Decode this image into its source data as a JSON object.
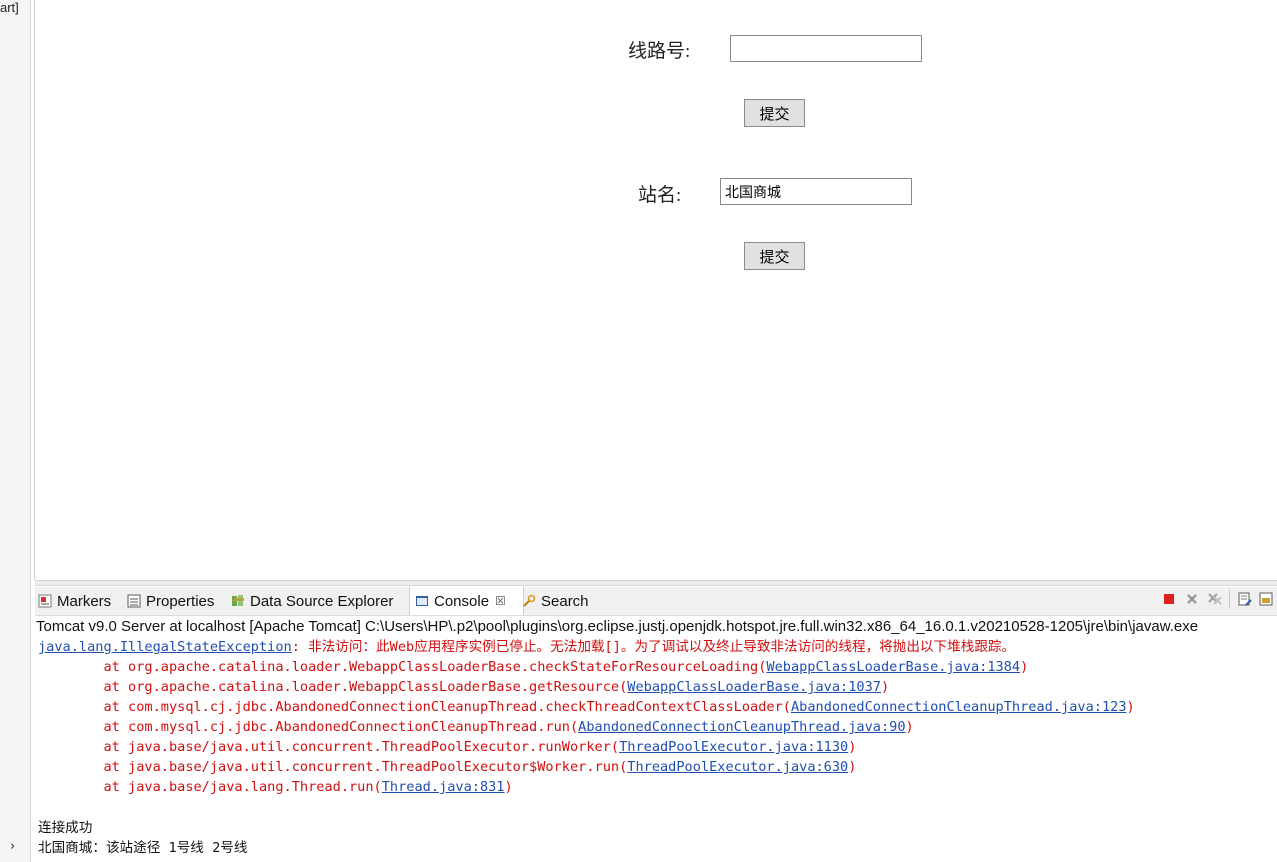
{
  "left_clip_text": "art]",
  "form": {
    "line_label": "线路号:",
    "line_value": "",
    "submit1": "提交",
    "station_label": "站名:",
    "station_value": "北国商城",
    "submit2": "提交"
  },
  "tabs": [
    {
      "label": "Markers",
      "icon": "markers-icon"
    },
    {
      "label": "Properties",
      "icon": "properties-icon"
    },
    {
      "label": "Data Source Explorer",
      "icon": "data-source-icon"
    },
    {
      "label": "Console",
      "icon": "console-icon",
      "close": "☒"
    },
    {
      "label": "Search",
      "icon": "search-icon"
    }
  ],
  "console_title": "Tomcat v9.0 Server at localhost [Apache Tomcat] C:\\Users\\HP\\.p2\\pool\\plugins\\org.eclipse.justj.openjdk.hotspot.jre.full.win32.x86_64_16.0.1.v20210528-1205\\jre\\bin\\javaw.exe",
  "console": {
    "exception_link": "java.lang.IllegalStateException",
    "exception_msg": ": 非法访问：此Web应用程序实例已停止。无法加载[]。为了调试以及终止导致非法访问的线程，将抛出以下堆栈跟踪。",
    "frames": [
      {
        "prefix": "        at org.apache.catalina.loader.WebappClassLoaderBase.checkStateForResourceLoading(",
        "link": "WebappClassLoaderBase.java:1384",
        "suffix": ")"
      },
      {
        "prefix": "        at org.apache.catalina.loader.WebappClassLoaderBase.getResource(",
        "link": "WebappClassLoaderBase.java:1037",
        "suffix": ")"
      },
      {
        "prefix": "        at com.mysql.cj.jdbc.AbandonedConnectionCleanupThread.checkThreadContextClassLoader(",
        "link": "AbandonedConnectionCleanupThread.java:123",
        "suffix": ")"
      },
      {
        "prefix": "        at com.mysql.cj.jdbc.AbandonedConnectionCleanupThread.run(",
        "link": "AbandonedConnectionCleanupThread.java:90",
        "suffix": ")"
      },
      {
        "prefix": "        at java.base/java.util.concurrent.ThreadPoolExecutor.runWorker(",
        "link": "ThreadPoolExecutor.java:1130",
        "suffix": ")"
      },
      {
        "prefix": "        at java.base/java.util.concurrent.ThreadPoolExecutor$Worker.run(",
        "link": "ThreadPoolExecutor.java:630",
        "suffix": ")"
      },
      {
        "prefix": "        at java.base/java.lang.Thread.run(",
        "link": "Thread.java:831",
        "suffix": ")"
      }
    ],
    "output1": "连接成功",
    "output2": "北国商城：该站途径 1号线 2号线"
  },
  "colors": {
    "error": "#d01010",
    "link": "#1f4fb0",
    "terminate": "#e02020"
  }
}
